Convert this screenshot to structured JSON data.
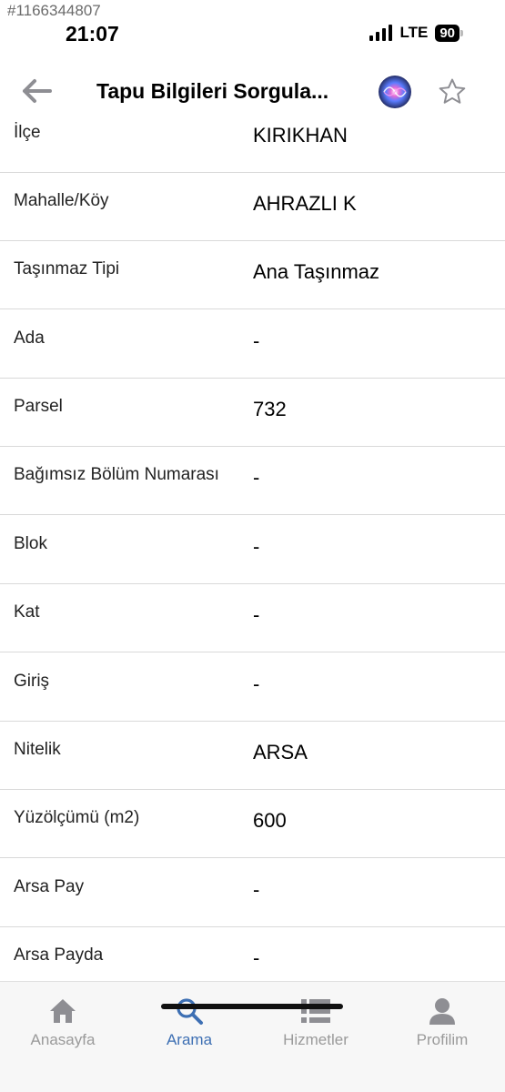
{
  "watermark": "#1166344807",
  "status_bar": {
    "time": "21:07",
    "network": "LTE",
    "battery": "90"
  },
  "nav": {
    "title": "Tapu Bilgileri Sorgula..."
  },
  "rows": [
    {
      "label": "İlçe",
      "value": "KIRIKHAN"
    },
    {
      "label": "Mahalle/Köy",
      "value": "AHRAZLI K"
    },
    {
      "label": "Taşınmaz Tipi",
      "value": "Ana Taşınmaz"
    },
    {
      "label": "Ada",
      "value": "-"
    },
    {
      "label": "Parsel",
      "value": "732"
    },
    {
      "label": "Bağımsız Bölüm Numarası",
      "value": "-"
    },
    {
      "label": "Blok",
      "value": "-"
    },
    {
      "label": "Kat",
      "value": "-"
    },
    {
      "label": "Giriş",
      "value": "-"
    },
    {
      "label": "Nitelik",
      "value": "ARSA"
    },
    {
      "label": "Yüzölçümü (m2)",
      "value": "600"
    },
    {
      "label": "Arsa Pay",
      "value": "-"
    },
    {
      "label": "Arsa Payda",
      "value": "-"
    }
  ],
  "tabs": [
    {
      "label": "Anasayfa",
      "icon": "home-icon",
      "active": false
    },
    {
      "label": "Arama",
      "icon": "search-icon",
      "active": true
    },
    {
      "label": "Hizmetler",
      "icon": "list-icon",
      "active": false
    },
    {
      "label": "Profilim",
      "icon": "profile-icon",
      "active": false
    }
  ],
  "colors": {
    "accent": "#3d6fb3",
    "inactive": "#9a9a9a",
    "divider": "#d9d9d9"
  }
}
